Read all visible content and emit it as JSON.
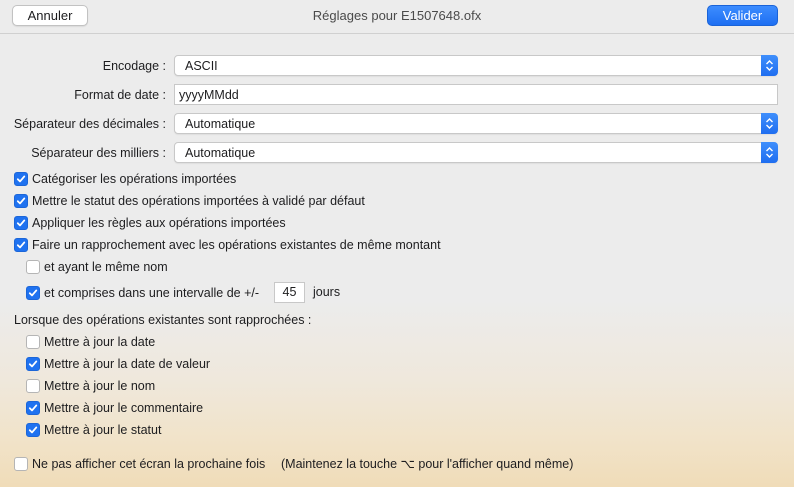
{
  "header": {
    "cancel_label": "Annuler",
    "title": "Réglages pour E1507648.ofx",
    "confirm_label": "Valider"
  },
  "fields": {
    "encoding": {
      "label": "Encodage :",
      "value": "ASCII"
    },
    "date_format": {
      "label": "Format de date :",
      "value": "yyyyMMdd"
    },
    "decimal_separator": {
      "label": "Séparateur des décimales :",
      "value": "Automatique"
    },
    "thousands_separator": {
      "label": "Séparateur des milliers :",
      "value": "Automatique"
    }
  },
  "options": [
    {
      "label": "Catégoriser les opérations importées",
      "checked": true
    },
    {
      "label": "Mettre le statut des opérations importées à validé par défaut",
      "checked": true
    },
    {
      "label": "Appliquer les règles aux opérations importées",
      "checked": true
    },
    {
      "label": "Faire un rapprochement avec les opérations existantes de même montant",
      "checked": true
    }
  ],
  "match": {
    "same_name": {
      "label": "et ayant le même nom",
      "checked": false
    },
    "interval": {
      "label": "et comprises dans une intervalle de +/-",
      "checked": true,
      "value": "45",
      "unit": "jours"
    }
  },
  "reconcile": {
    "heading": "Lorsque des opérations existantes sont rapprochées :",
    "items": [
      {
        "label": "Mettre à jour la date",
        "checked": false
      },
      {
        "label": "Mettre à jour la date de valeur",
        "checked": true
      },
      {
        "label": "Mettre à jour le nom",
        "checked": false
      },
      {
        "label": "Mettre à jour le commentaire",
        "checked": true
      },
      {
        "label": "Mettre à jour le statut",
        "checked": true
      }
    ]
  },
  "footer": {
    "dont_show": {
      "label": "Ne pas afficher cet écran la prochaine fois",
      "checked": false
    },
    "hint": "(Maintenez la touche ⌥ pour l'afficher quand même)"
  },
  "colors": {
    "accent": "#1f72f0",
    "background": "#ececec"
  }
}
